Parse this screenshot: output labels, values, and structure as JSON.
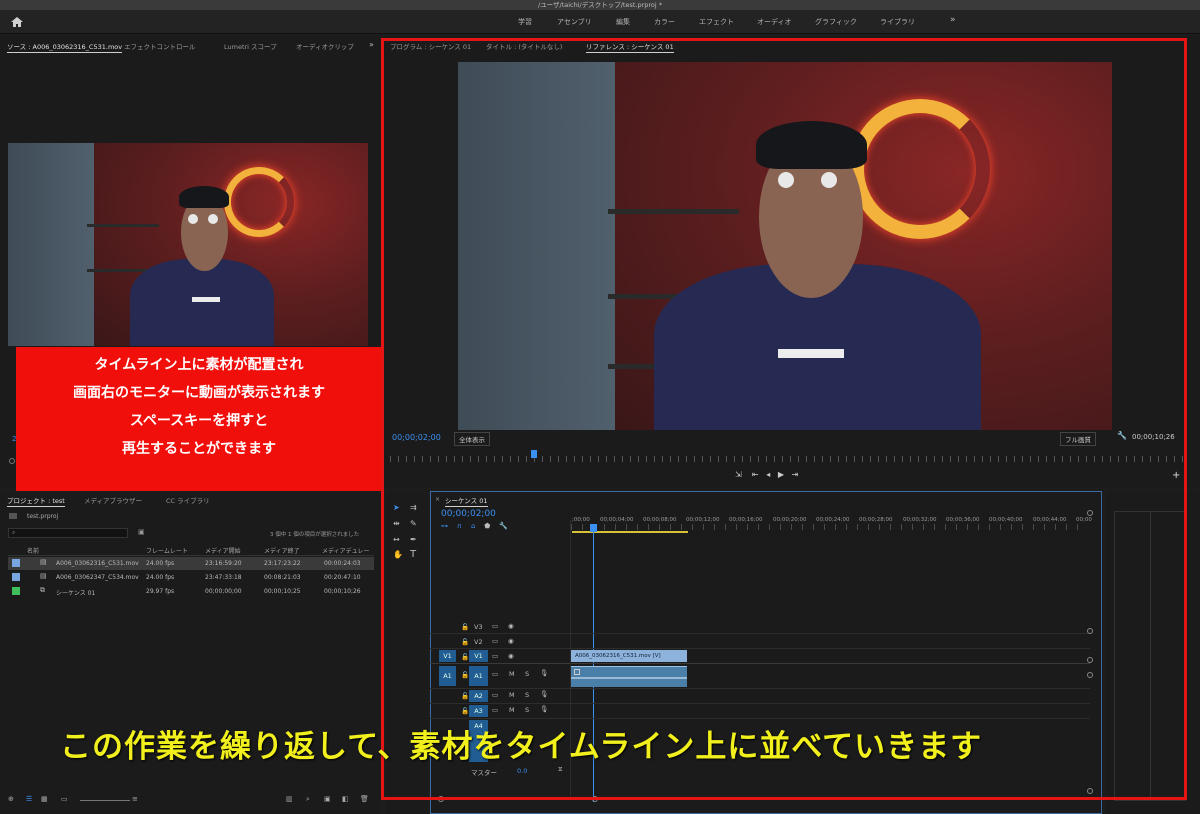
{
  "window": {
    "title": "/ユーザ/taichi/デスクトップ/test.prproj *"
  },
  "workspaces": [
    "学習",
    "アセンブリ",
    "編集",
    "カラー",
    "エフェクト",
    "オーディオ",
    "グラフィック",
    "ライブラリ"
  ],
  "source_panel": {
    "tabs": [
      "ソース : A006_03062316_C531.mov",
      "エフェクトコントロール",
      "Lumetri スコープ",
      "オーディオクリップ"
    ],
    "timecode": "2"
  },
  "program_panel": {
    "tabs": [
      "プログラム : シーケンス 01",
      "タイトル : (タイトルなし)",
      "リファレンス : シーケンス 01"
    ],
    "timecode": "00;00;02;00",
    "zoom": "全体表示",
    "quality": "フル画質",
    "duration": "00;00;10;26"
  },
  "project_panel": {
    "tabs": [
      "プロジェクト : test",
      "メディアブラウザー",
      "CC ライブラリ"
    ],
    "file": "test.prproj",
    "selection_info": "3 個中 1 個の項目が選択されました",
    "columns": [
      "名前",
      "フレームレート",
      "メディア開始",
      "メディア終了",
      "メディアデュレー"
    ],
    "rows": [
      {
        "name": "A006_03062316_C531.mov",
        "fps": "24.00 fps",
        "start": "23:16:59:20",
        "end": "23:17:23:22",
        "duration": "00:00:24:03",
        "color": "#7aa6e0"
      },
      {
        "name": "A006_03062347_C534.mov",
        "fps": "24.00 fps",
        "start": "23:47:33:18",
        "end": "00:08:21:03",
        "duration": "00:20:47:10",
        "color": "#7aa6e0"
      },
      {
        "name": "シーケンス 01",
        "fps": "29.97 fps",
        "start": "00;00;00;00",
        "end": "00;00;10;25",
        "duration": "00;00;10;26",
        "color": "#3fbf5a"
      }
    ]
  },
  "timeline": {
    "tab": "シーケンス 01",
    "timecode": "00;00;02;00",
    "ruler": [
      ";00;00",
      "00;00;04;00",
      "00;00;08;00",
      "00;00;12;00",
      "00;00;16;00",
      "00;00;20;00",
      "00;00;24;00",
      "00;00;28;00",
      "00;00;32;00",
      "00;00;36;00",
      "00;00;40;00",
      "00;00;44;00",
      "00;00"
    ],
    "video_tracks": [
      "V3",
      "V2",
      "V1"
    ],
    "audio_tracks": [
      "A1",
      "A2",
      "A3",
      "A4"
    ],
    "source_v": "V1",
    "source_a": "A1",
    "clip_name": "A006_03062316_C531.mov [V]",
    "master_label": "マスター",
    "master_value": "0.0",
    "mute": "M",
    "solo": "S"
  },
  "overlay": {
    "red_lines": [
      "タイムライン上に素材が配置され",
      "画面右のモニターに動画が表示されます",
      "スペースキーを押すと",
      "再生することができます"
    ],
    "caption": "この作業を繰り返して、素材をタイムライン上に並べていきます"
  },
  "colors": {
    "accent": "#2b8cf0",
    "highlight_red": "#f10f0b",
    "caption_yellow": "#f2f01c",
    "border_red": "#e51515"
  }
}
